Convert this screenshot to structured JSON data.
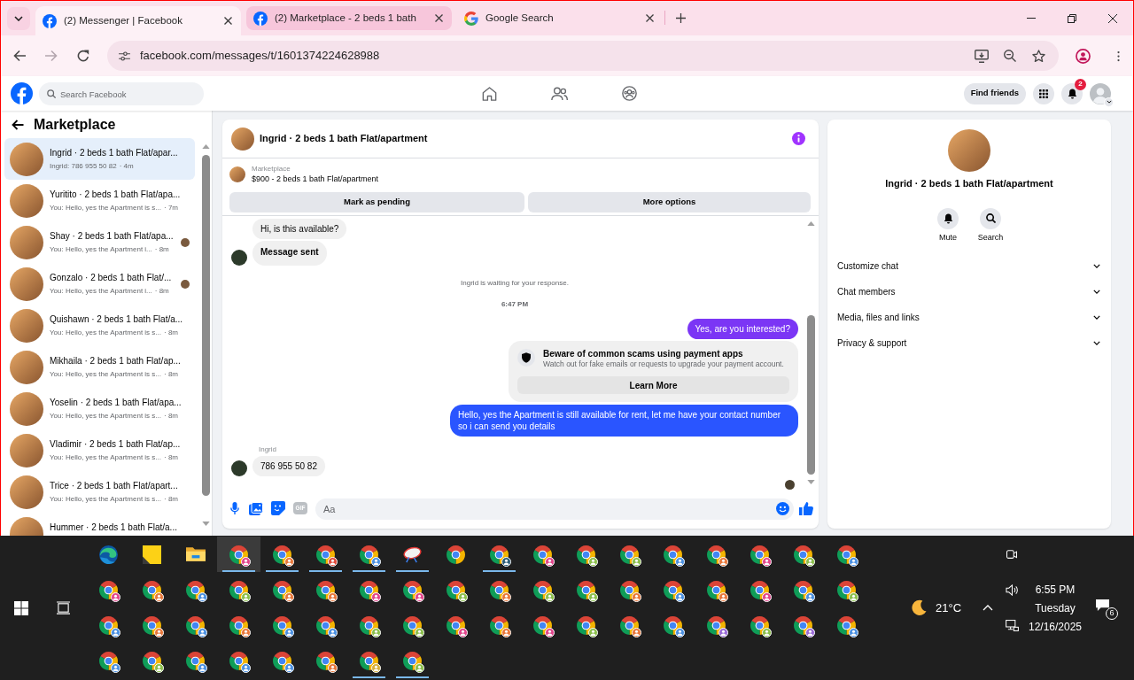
{
  "browser": {
    "tabs": [
      {
        "title": "(2) Messenger | Facebook",
        "kind": "facebook",
        "selected": true,
        "highlighted": false
      },
      {
        "title": "(2) Marketplace - 2 beds 1 bath",
        "kind": "facebook",
        "selected": false,
        "highlighted": true
      },
      {
        "title": "Google Search",
        "kind": "google",
        "selected": false,
        "highlighted": false
      }
    ],
    "url": "facebook.com/messages/t/1601374224628988"
  },
  "facebook": {
    "search": {
      "placeholder": "Search Facebook"
    },
    "find_friends": "Find friends",
    "notification_count": "2"
  },
  "sidebar": {
    "title": "Marketplace",
    "conversations": [
      {
        "title": "Ingrid · 2 beds 1 bath Flat/apar...",
        "preview": "Ingrid: 786 955 50 82",
        "time": "· 4m",
        "selected": true,
        "seen": false
      },
      {
        "title": "Yuritito · 2 beds 1 bath Flat/apa...",
        "preview": "You: Hello, yes the Apartment is s...",
        "time": "· 7m",
        "selected": false,
        "seen": false
      },
      {
        "title": "Shay · 2 beds 1 bath Flat/apa...",
        "preview": "You: Hello, yes the Apartment i...",
        "time": "· 8m",
        "selected": false,
        "seen": true
      },
      {
        "title": "Gonzalo · 2 beds 1 bath Flat/...",
        "preview": "You: Hello, yes the Apartment i...",
        "time": "· 8m",
        "selected": false,
        "seen": true
      },
      {
        "title": "Quishawn · 2 beds 1 bath Flat/a...",
        "preview": "You: Hello, yes the Apartment is s...",
        "time": "· 8m",
        "selected": false,
        "seen": false
      },
      {
        "title": "Mikhaila · 2 beds 1 bath Flat/ap...",
        "preview": "You: Hello, yes the Apartment is s...",
        "time": "· 8m",
        "selected": false,
        "seen": false
      },
      {
        "title": "Yoselin · 2 beds 1 bath Flat/apa...",
        "preview": "You: Hello, yes the Apartment is s...",
        "time": "· 8m",
        "selected": false,
        "seen": false
      },
      {
        "title": "Vladimir · 2 beds 1 bath Flat/ap...",
        "preview": "You: Hello, yes the Apartment is s...",
        "time": "· 8m",
        "selected": false,
        "seen": false
      },
      {
        "title": "Trice · 2 beds 1 bath Flat/apart...",
        "preview": "You: Hello, yes the Apartment is s...",
        "time": "· 8m",
        "selected": false,
        "seen": false
      },
      {
        "title": "Hummer · 2 beds 1 bath Flat/a...",
        "selected": false,
        "seen": false
      }
    ]
  },
  "chat": {
    "title": "Ingrid · 2 beds 1 bath Flat/apartment",
    "listing": {
      "label": "Marketplace",
      "title": "$900 - 2 beds 1 bath Flat/apartment"
    },
    "actions": [
      "Mark as pending",
      "More options"
    ],
    "messages": [
      {
        "kind": "incoming",
        "text": "Hi, is this available?",
        "avatar": false
      },
      {
        "kind": "auto",
        "text": "Message sent",
        "avatar": true
      },
      {
        "kind": "notice",
        "text": "Ingrid is waiting for your response."
      },
      {
        "kind": "timestamp",
        "text": "6:47 PM"
      },
      {
        "kind": "outgoing",
        "text": "Yes, are you interested?",
        "color": "#7b36f5"
      },
      {
        "kind": "warning",
        "title": "Beware of common scams using payment apps",
        "body": "Watch out for fake emails or requests to upgrade your payment account.",
        "button": "Learn More"
      },
      {
        "kind": "outgoing",
        "text": "Hello, yes the Apartment is still available for rent, let me have your contact number so i can send you details",
        "color": "#2a55ff"
      },
      {
        "kind": "sender",
        "text": "Ingrid"
      },
      {
        "kind": "incoming",
        "text": "786 955 50 82",
        "avatar": true
      }
    ],
    "seen": true,
    "composer": {
      "placeholder": "Aa",
      "gif": "GIF"
    }
  },
  "details": {
    "title": "Ingrid · 2 beds 1 bath Flat/apartment",
    "actions": [
      {
        "kind": "mute",
        "label": "Mute"
      },
      {
        "kind": "search",
        "label": "Search"
      }
    ],
    "sections": [
      {
        "label": "Customize chat",
        "expanded": false
      },
      {
        "label": "Chat members",
        "expanded": false
      },
      {
        "label": "Media, files and links",
        "expanded": false
      },
      {
        "label": "Privacy & support",
        "expanded": false
      }
    ]
  },
  "taskbar": {
    "apps": [
      {
        "kind": "edge",
        "running": false,
        "active": false
      },
      {
        "kind": "sticky-notes",
        "running": false,
        "active": false
      },
      {
        "kind": "file-explorer",
        "running": false,
        "active": false
      },
      {
        "kind": "chrome",
        "color": "#e2458c",
        "running": true,
        "active": true
      },
      {
        "kind": "chrome",
        "color": "#e8773a",
        "running": true,
        "active": false
      },
      {
        "kind": "chrome",
        "color": "#e04a3a",
        "running": true,
        "active": false
      },
      {
        "kind": "chrome",
        "color": "#4a90e2",
        "running": true,
        "active": false
      },
      {
        "kind": "disc",
        "running": true,
        "active": false
      },
      {
        "kind": "chrome",
        "running": false,
        "active": false
      },
      {
        "kind": "chrome",
        "color": "#2d5d78",
        "running": true,
        "active": false
      },
      {
        "kind": "chrome",
        "color": "#e2458c",
        "running": false,
        "active": false
      },
      {
        "kind": "chrome",
        "color": "#8bbf4b",
        "running": false,
        "active": false
      },
      {
        "kind": "chrome",
        "color": "#8bbf4b",
        "running": false,
        "active": false
      },
      {
        "kind": "chrome",
        "color": "#4a90e2",
        "running": false,
        "active": false
      },
      {
        "kind": "chrome",
        "color": "#e8773a",
        "running": false,
        "active": false
      },
      {
        "kind": "chrome",
        "color": "#e2458c",
        "running": false,
        "active": false
      },
      {
        "kind": "chrome",
        "color": "#8bbf4b",
        "running": false,
        "active": false
      },
      {
        "kind": "chrome",
        "color": "#4a90e2",
        "running": false,
        "active": false
      },
      {
        "kind": "chrome",
        "color": "#e2458c",
        "running": false,
        "active": false
      },
      {
        "kind": "chrome",
        "color": "#e8773a",
        "running": false,
        "active": false
      },
      {
        "kind": "chrome",
        "color": "#4a90e2",
        "running": false,
        "active": false
      },
      {
        "kind": "chrome",
        "color": "#8bbf4b",
        "running": false,
        "active": false
      },
      {
        "kind": "chrome",
        "color": "#e8773a",
        "running": false,
        "active": false
      },
      {
        "kind": "chrome",
        "color": "#e8773a",
        "running": false,
        "active": false
      },
      {
        "kind": "chrome",
        "color": "#e2458c",
        "running": false,
        "active": false
      },
      {
        "kind": "chrome",
        "color": "#e2458c",
        "running": false,
        "active": false
      },
      {
        "kind": "chrome",
        "color": "#8bbf4b",
        "running": false,
        "active": false
      },
      {
        "kind": "chrome",
        "color": "#e8773a",
        "running": false,
        "active": false
      },
      {
        "kind": "chrome",
        "color": "#8bbf4b",
        "running": false,
        "active": false
      },
      {
        "kind": "chrome",
        "color": "#8bbf4b",
        "running": false,
        "active": false
      },
      {
        "kind": "chrome",
        "color": "#e8773a",
        "running": false,
        "active": false
      },
      {
        "kind": "chrome",
        "color": "#4a90e2",
        "running": false,
        "active": false
      },
      {
        "kind": "chrome",
        "color": "#e8773a",
        "running": false,
        "active": false
      },
      {
        "kind": "chrome",
        "color": "#e2458c",
        "running": false,
        "active": false
      },
      {
        "kind": "chrome",
        "color": "#4a90e2",
        "running": false,
        "active": false
      },
      {
        "kind": "chrome",
        "color": "#8bbf4b",
        "running": false,
        "active": false
      },
      {
        "kind": "chrome",
        "color": "#4a90e2",
        "running": false,
        "active": false
      },
      {
        "kind": "chrome",
        "color": "#e8773a",
        "running": false,
        "active": false
      },
      {
        "kind": "chrome",
        "color": "#4a90e2",
        "running": false,
        "active": false
      },
      {
        "kind": "chrome",
        "color": "#e8773a",
        "running": false,
        "active": false
      },
      {
        "kind": "chrome",
        "color": "#4a90e2",
        "running": false,
        "active": false
      },
      {
        "kind": "chrome",
        "color": "#4a90e2",
        "running": false,
        "active": false
      },
      {
        "kind": "chrome",
        "color": "#8bbf4b",
        "running": false,
        "active": false
      },
      {
        "kind": "chrome",
        "color": "#8bbf4b",
        "running": false,
        "active": false
      },
      {
        "kind": "chrome",
        "color": "#e2458c",
        "running": false,
        "active": false
      },
      {
        "kind": "chrome",
        "color": "#e8773a",
        "running": false,
        "active": false
      },
      {
        "kind": "chrome",
        "color": "#e2458c",
        "running": false,
        "active": false
      },
      {
        "kind": "chrome",
        "color": "#8bbf4b",
        "running": false,
        "active": false
      },
      {
        "kind": "chrome",
        "color": "#e8773a",
        "running": false,
        "active": false
      },
      {
        "kind": "chrome",
        "color": "#4a90e2",
        "running": false,
        "active": false
      },
      {
        "kind": "chrome",
        "color": "#9a6bd8",
        "running": false,
        "active": false
      },
      {
        "kind": "chrome",
        "color": "#8bbf4b",
        "running": false,
        "active": false
      },
      {
        "kind": "chrome",
        "color": "#9a6bd8",
        "running": false,
        "active": false
      },
      {
        "kind": "chrome",
        "color": "#4a90e2",
        "running": false,
        "active": false
      },
      {
        "kind": "chrome",
        "color": "#4a90e2",
        "running": false,
        "active": false
      },
      {
        "kind": "chrome",
        "color": "#8bbf4b",
        "running": false,
        "active": false
      },
      {
        "kind": "chrome",
        "color": "#4a90e2",
        "running": false,
        "active": false
      },
      {
        "kind": "chrome",
        "color": "#4a90e2",
        "running": false,
        "active": false
      },
      {
        "kind": "chrome",
        "color": "#4a90e2",
        "running": false,
        "active": false
      },
      {
        "kind": "chrome",
        "color": "#e8773a",
        "running": false,
        "active": false
      },
      {
        "kind": "chrome",
        "color": "#d8b13c",
        "running": true,
        "active": false
      },
      {
        "kind": "chrome",
        "color": "#8bbf4b",
        "running": true,
        "active": false
      }
    ],
    "weather": "21°C",
    "clock": {
      "time": "6:55 PM",
      "day": "Tuesday",
      "date": "12/16/2025"
    },
    "notification_count": "6"
  }
}
